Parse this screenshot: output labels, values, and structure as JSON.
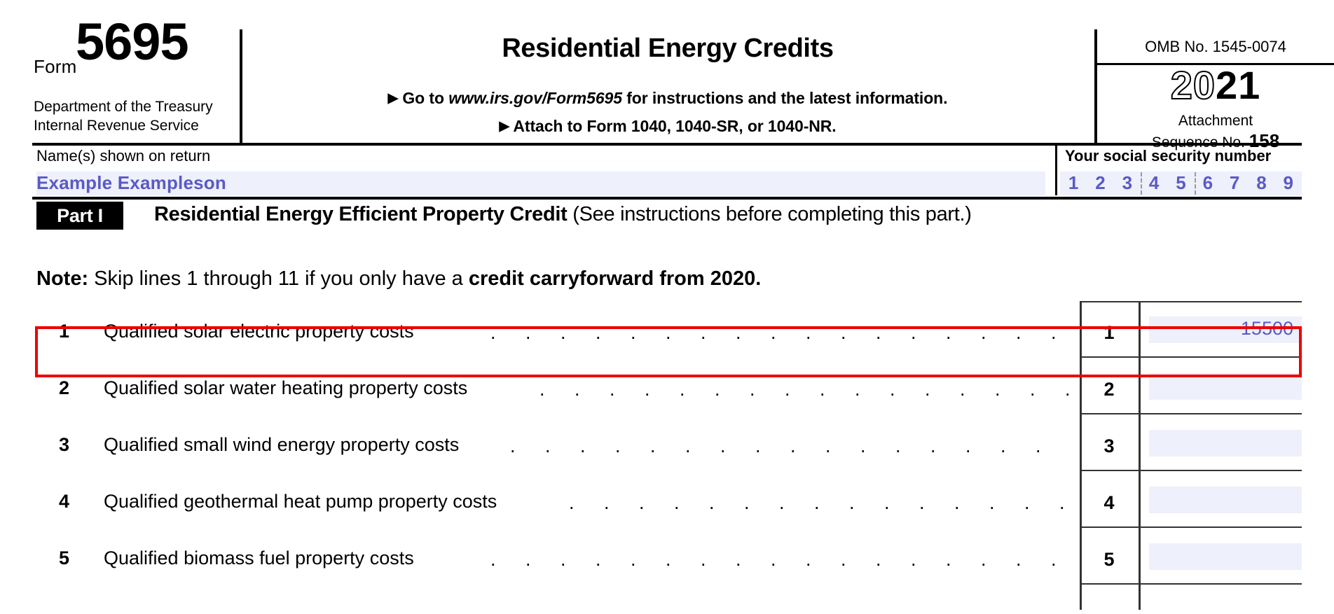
{
  "form": {
    "form_word": "Form",
    "form_number": "5695",
    "department_line1": "Department of the Treasury",
    "department_line2": "Internal Revenue Service",
    "title": "Residential Energy Credits",
    "subline1_prefix": "Go to ",
    "subline1_url": "www.irs.gov/Form5695",
    "subline1_suffix": " for instructions and the latest information.",
    "subline2": "Attach to Form 1040, 1040-SR, or 1040-NR.",
    "arrow_glyph": "▶",
    "omb": "OMB No. 1545-0074",
    "year_hollow": "20",
    "year_solid": "21",
    "attachment_label_line1": "Attachment",
    "attachment_label_line2": "Sequence No.",
    "attachment_number": "158"
  },
  "identity": {
    "name_label": "Name(s) shown on return",
    "name_value": "Example Exampleson",
    "ssn_label": "Your social security number",
    "ssn_digits": [
      "1",
      "2",
      "3",
      "4",
      "5",
      "6",
      "7",
      "8",
      "9"
    ]
  },
  "part": {
    "badge": "Part I",
    "heading_bold": "Residential Energy Efficient Property Credit",
    "heading_normal": " (See instructions before completing this part.)",
    "note_prefix_bold": "Note:",
    "note_text": " Skip lines 1 through 11 if you only have a ",
    "note_suffix_bold": "credit carryforward from 2020."
  },
  "lines": [
    {
      "number": "1",
      "label": "Qualified solar electric property costs",
      "ref": "1",
      "value": "15500",
      "highlighted": true
    },
    {
      "number": "2",
      "label": "Qualified solar water heating property costs",
      "ref": "2",
      "value": "",
      "highlighted": false
    },
    {
      "number": "3",
      "label": "Qualified small wind energy property costs",
      "ref": "3",
      "value": "",
      "highlighted": false
    },
    {
      "number": "4",
      "label": "Qualified geothermal heat pump property costs",
      "ref": "4",
      "value": "",
      "highlighted": false
    },
    {
      "number": "5",
      "label": "Qualified biomass fuel property costs",
      "ref": "5",
      "value": "",
      "highlighted": false
    }
  ],
  "colors": {
    "filled_value": "#5a5ac6",
    "field_background": "#eef0fb",
    "highlight_border": "#ee0000",
    "rule": "#000000"
  }
}
